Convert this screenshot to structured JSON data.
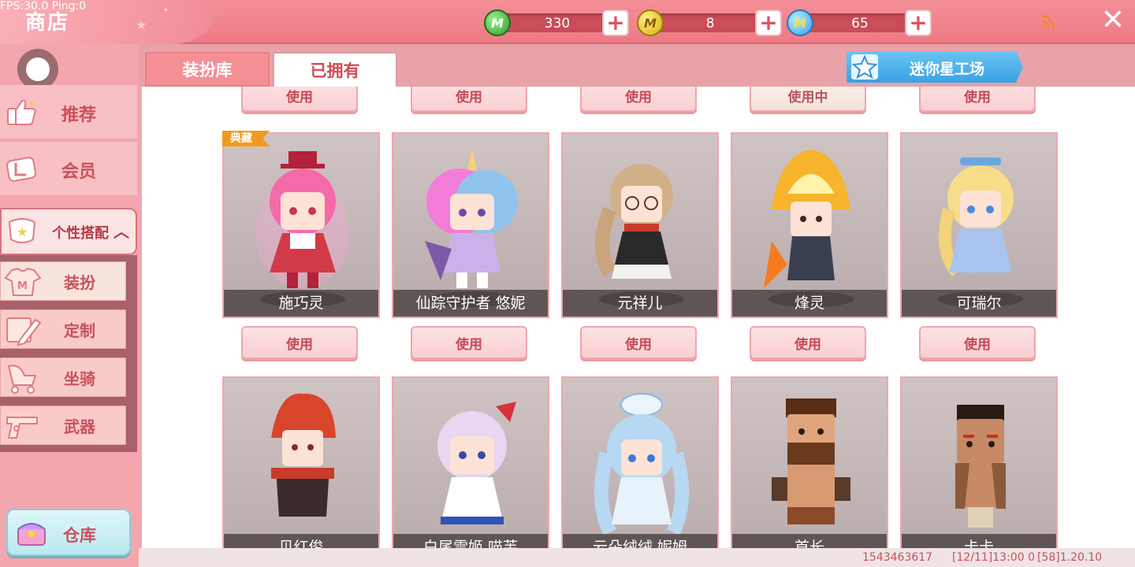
{
  "debug": {
    "fps_text": "FPS:30.0  Ping:0"
  },
  "header": {
    "title": "商店"
  },
  "currencies": [
    {
      "name": "mini-bean",
      "value": "330",
      "color": "#3fae37"
    },
    {
      "name": "mini-coin",
      "value": "8",
      "color": "#e3b812"
    },
    {
      "name": "mini-point",
      "value": "65",
      "color": "#3aa0e8"
    }
  ],
  "sidebar": {
    "categories": [
      {
        "label": "推荐"
      },
      {
        "label": "会员"
      }
    ],
    "expanded": {
      "label": "个性搭配"
    },
    "subitems": [
      {
        "label": "装扮",
        "active": true
      },
      {
        "label": "定制"
      },
      {
        "label": "坐骑"
      },
      {
        "label": "武器"
      }
    ],
    "warehouse": {
      "label": "仓库"
    }
  },
  "tabs": [
    {
      "label": "装扮库"
    },
    {
      "label": "已拥有"
    }
  ],
  "workshop": {
    "label": "迷你星工场"
  },
  "top_row_buttons": [
    "使用",
    "使用",
    "使用",
    "使用中",
    "使用"
  ],
  "row1": [
    {
      "name": "施巧灵",
      "badge": "典藏",
      "hair": "#f56aa8",
      "outfit": "#d23a4a"
    },
    {
      "name": "仙踪守护者 悠妮",
      "hair": "#f37cd8",
      "outfit": "#cbb1ea"
    },
    {
      "name": "元祥儿",
      "hair": "#d2b08a",
      "outfit": "#2a2a2a"
    },
    {
      "name": "烽灵",
      "hair": "#f7b42c",
      "outfit": "#3a4052"
    },
    {
      "name": "可瑞尔",
      "hair": "#f7dc8a",
      "outfit": "#a9c4ee"
    }
  ],
  "row1_buttons": [
    "使用",
    "使用",
    "使用",
    "使用",
    "使用"
  ],
  "row2": [
    {
      "name": "贝红俊",
      "hair": "#d8452a",
      "outfit": "#3a2a2a"
    },
    {
      "name": "白尾雪姬 喵芙",
      "hair": "#e8d6f2",
      "outfit": "#2f55b8"
    },
    {
      "name": "云朵绒绒 妮姆",
      "hair": "#b7d8f2",
      "outfit": "#e8f2fb"
    },
    {
      "name": "首长",
      "hair": "#6a3a1e",
      "outfit": "#8a4a2a"
    },
    {
      "name": "卡卡",
      "hair": "#2a1a14",
      "outfit": "#8a5a3a"
    }
  ],
  "footer": {
    "uid": "1543463617",
    "time": "[12/11]13:00 0",
    "version": "[58]1.20.10"
  }
}
